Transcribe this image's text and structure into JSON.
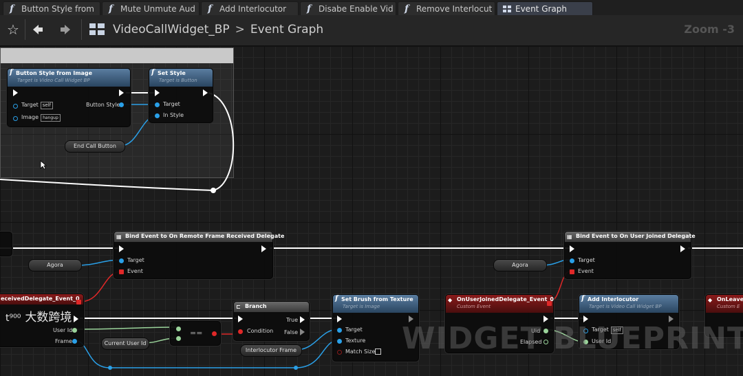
{
  "tabs": [
    {
      "label": "Button Style from",
      "icon": "function-icon"
    },
    {
      "label": "Mute Unmute Aud",
      "icon": "function-icon"
    },
    {
      "label": "Add Interlocutor",
      "icon": "function-icon"
    },
    {
      "label": "Disabe Enable Vid",
      "icon": "function-icon"
    },
    {
      "label": "Remove Interlocut",
      "icon": "function-icon"
    },
    {
      "label": "Event Graph",
      "icon": "graph-icon",
      "active": true
    }
  ],
  "breadcrumb": {
    "blueprint": "VideoCallWidget_BP",
    "separator": ">",
    "graph": "Event Graph"
  },
  "zoom": "Zoom -3",
  "nodes": {
    "button_style": {
      "title": "Button Style from Image",
      "subtitle": "Target is Video Call Widget BP",
      "target_label": "Target",
      "target_value": "self",
      "image_label": "Image",
      "image_value": "hangup",
      "output_label": "Button Style"
    },
    "set_style": {
      "title": "Set Style",
      "subtitle": "Target is Button",
      "target_label": "Target",
      "style_label": "In Style"
    },
    "end_call": {
      "label": "End Call Button"
    },
    "bind_remote": {
      "title": "Bind Event to On Remote Frame Received Delegate",
      "target_label": "Target",
      "event_label": "Event"
    },
    "agora1": {
      "label": "Agora"
    },
    "bind_joined": {
      "title": "Bind Event to On User Joined Delegate",
      "target_label": "Target",
      "event_label": "Event"
    },
    "agora2": {
      "label": "Agora"
    },
    "received_event": {
      "title": "eceivedDelegate_Event_0",
      "userid_label": "User Id",
      "frame_label": "Frame"
    },
    "equals": {
      "label": "=="
    },
    "current_user": {
      "label": "Current User Id"
    },
    "branch": {
      "title": "Branch",
      "condition_label": "Condition",
      "true_label": "True",
      "false_label": "False"
    },
    "interlocutor_frame": {
      "label": "Interlocutor Frame"
    },
    "set_brush": {
      "title": "Set Brush from Texture",
      "subtitle": "Target is Image",
      "target_label": "Target",
      "texture_label": "Texture",
      "match_label": "Match Size"
    },
    "joined_event": {
      "title": "OnUserJoinedDelegate_Event_0",
      "subtitle": "Custom Event",
      "uid_label": "Uid",
      "elapsed_label": "Elapsed"
    },
    "add_interlocutor": {
      "title": "Add Interlocutor",
      "subtitle": "Target is Video Call Widget BP",
      "target_label": "Target",
      "target_value": "self",
      "userid_label": "User Id"
    },
    "on_leave": {
      "title": "OnLeave",
      "subtitle": "Custom E"
    }
  },
  "watermark": "WIDGET BLUEPRINT",
  "logo": {
    "glyph": "t⁹⁰⁰",
    "text": "大数跨境"
  },
  "colors": {
    "exec": "#ffffff",
    "object_pin": "#2aa0e8",
    "delegate_pin": "#e02828",
    "int_pin": "#9bd49b",
    "function_header": "#3f6b8f",
    "event_header": "#8a1b1b"
  }
}
